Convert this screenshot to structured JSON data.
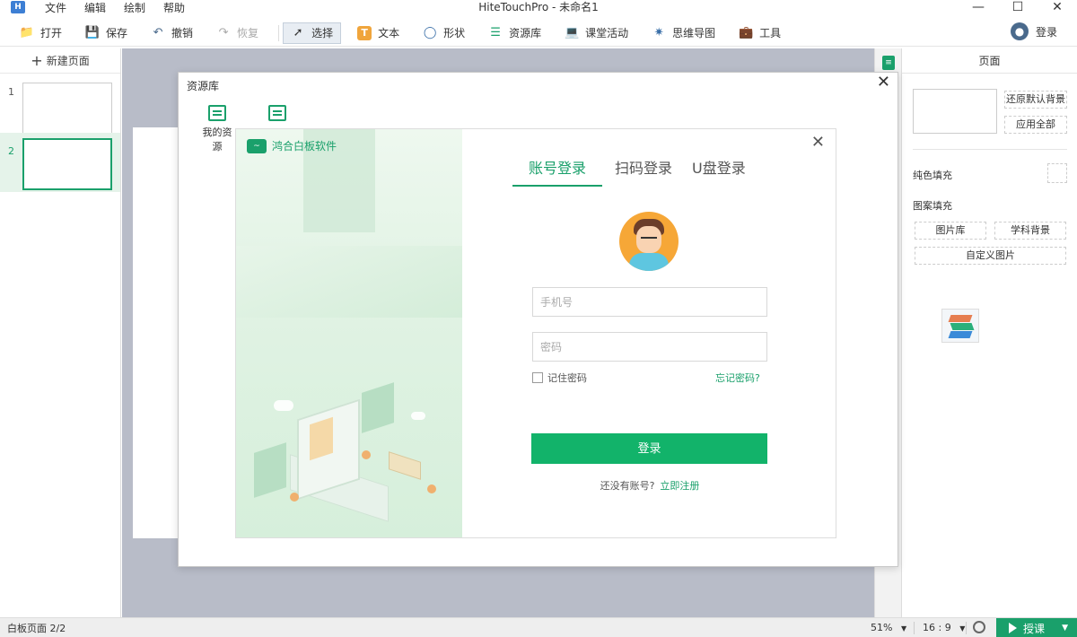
{
  "app": {
    "title": "HiteTouchPro - 未命名1",
    "menu": [
      "文件",
      "编辑",
      "绘制",
      "帮助"
    ]
  },
  "toolbar": {
    "open": "打开",
    "save": "保存",
    "undo": "撤销",
    "redo": "恢复",
    "select": "选择",
    "text": "文本",
    "shape": "形状",
    "resource": "资源库",
    "activity": "课堂活动",
    "mindmap": "思维导图",
    "tools": "工具",
    "login": "登录"
  },
  "left_panel": {
    "new_page": "新建页面",
    "pages": [
      {
        "num": "1",
        "selected": false
      },
      {
        "num": "2",
        "selected": true
      }
    ]
  },
  "right_panel": {
    "title": "页面",
    "restore_bg": "还原默认背景",
    "apply_all": "应用全部",
    "solid_fill": "纯色填充",
    "pattern_fill": "图案填充",
    "image_lib": "图片库",
    "subject_bg": "学科背景",
    "custom_img": "自定义图片"
  },
  "resource_dialog": {
    "title": "资源库",
    "tab_my": "我的资源"
  },
  "login_dialog": {
    "brand": "鸿合白板软件",
    "tabs": [
      "账号登录",
      "扫码登录",
      "U盘登录"
    ],
    "phone_placeholder": "手机号",
    "password_placeholder": "密码",
    "remember": "记住密码",
    "forgot": "忘记密码?",
    "submit": "登录",
    "no_account": "还没有账号?",
    "register": "立即注册"
  },
  "statusbar": {
    "page_info": "白板页面 2/2",
    "zoom": "51%",
    "ratio": "16 : 9",
    "class_button": "授课"
  },
  "colors": {
    "accent": "#1aa06b",
    "submit": "#12b36a",
    "canvas_bg": "#b8bcc8"
  }
}
